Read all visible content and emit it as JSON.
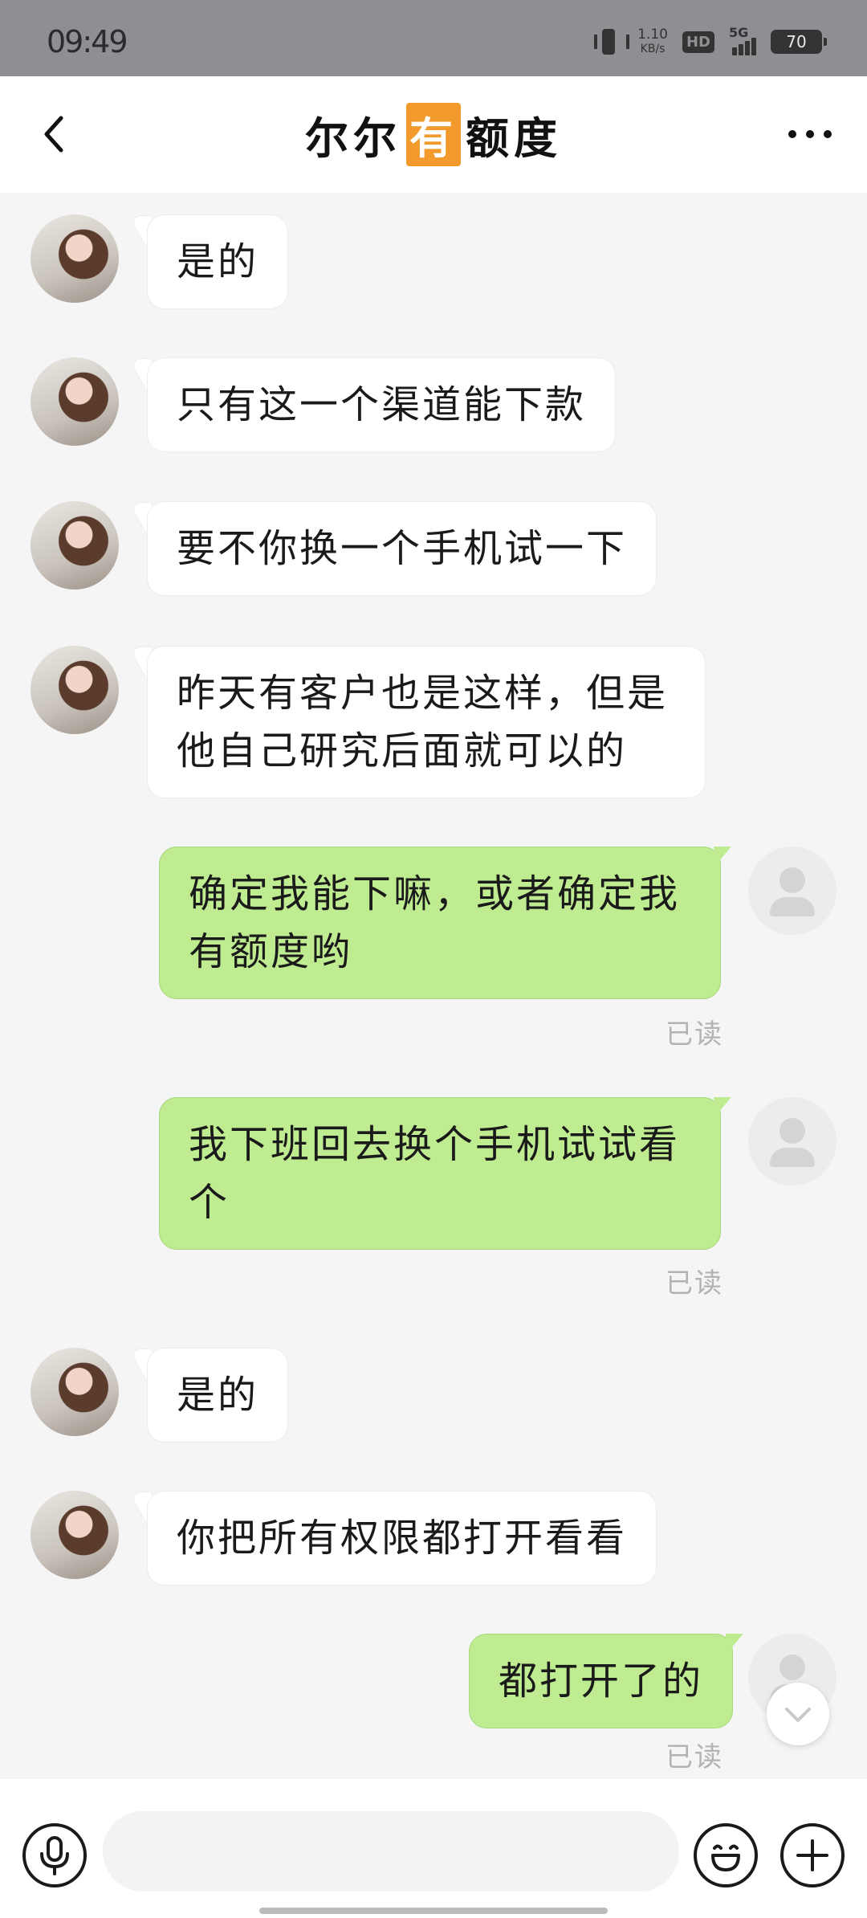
{
  "status_bar": {
    "time": "09:49",
    "net_speed_value": "1.10",
    "net_speed_unit": "KB/s",
    "hd_label": "HD",
    "network_label": "5G",
    "battery_level": "70"
  },
  "header": {
    "title_part1": "尔尔",
    "title_highlight": "有",
    "title_part2": "额度",
    "highlight_color": "#f39a2c"
  },
  "messages": [
    {
      "side": "in",
      "text": "是的"
    },
    {
      "side": "in",
      "text": "只有这一个渠道能下款"
    },
    {
      "side": "in",
      "text": "要不你换一个手机试一下"
    },
    {
      "side": "in",
      "line1": "昨天有客户也是这样，但是",
      "line2": "他自己研究后面就可以的"
    },
    {
      "side": "out",
      "line1": "确定我能下嘛，或者确定我",
      "line2": "有额度哟",
      "status": "已读"
    },
    {
      "side": "out",
      "line1": "我下班回去换个手机试试看",
      "line2": "个",
      "status": "已读"
    },
    {
      "side": "in",
      "text": "是的"
    },
    {
      "side": "in",
      "text": "你把所有权限都打开看看"
    },
    {
      "side": "out",
      "text": "都打开了的",
      "status": "已读"
    }
  ],
  "colors": {
    "outgoing_bubble": "#bfeb91",
    "incoming_bubble": "#ffffff",
    "chat_background": "#f5f5f5"
  },
  "input": {
    "value": "",
    "placeholder": ""
  },
  "icons": {
    "back": "chevron-left-icon",
    "more": "more-dots-icon",
    "voice": "microphone-icon",
    "emoji": "emoji-icon",
    "attach": "plus-icon",
    "scroll_down": "chevron-down-icon"
  }
}
